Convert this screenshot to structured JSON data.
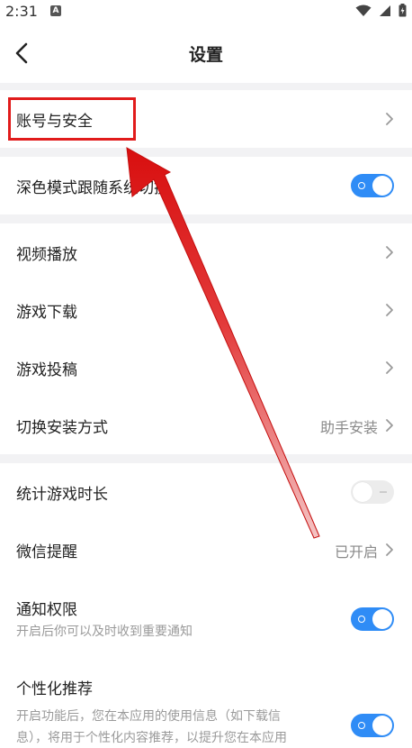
{
  "status_bar": {
    "time": "2:31",
    "notification_glyph": "A",
    "icons": [
      "wifi-icon",
      "signal-icon",
      "battery-icon"
    ]
  },
  "header": {
    "title": "设置",
    "back_icon": "chevron-left-icon"
  },
  "rows": {
    "account_security": {
      "label": "账号与安全"
    },
    "dark_mode": {
      "label": "深色模式跟随系统切换",
      "toggle": "on"
    },
    "video_playback": {
      "label": "视频播放"
    },
    "game_download": {
      "label": "游戏下载"
    },
    "game_submission": {
      "label": "游戏投稿"
    },
    "install_method": {
      "label": "切换安装方式",
      "value": "助手安装"
    },
    "game_time": {
      "label": "统计游戏时长",
      "toggle": "off"
    },
    "wechat_reminder": {
      "label": "微信提醒",
      "value": "已开启"
    },
    "notification": {
      "label": "通知权限",
      "description": "开启后你可以及时收到重要通知",
      "toggle": "on"
    },
    "personalized": {
      "label": "个性化推荐",
      "description_line1": "开启功能后，您在本应用的使用信息（如下载信",
      "description_line2": "息），将用于个性化内容推荐，以提升您在本应用",
      "toggle": "on"
    }
  },
  "annotation": {
    "color": "#e11b1b"
  },
  "colors": {
    "toggle_on": "#2f8cf6",
    "section_gap": "#f2f2f4"
  }
}
